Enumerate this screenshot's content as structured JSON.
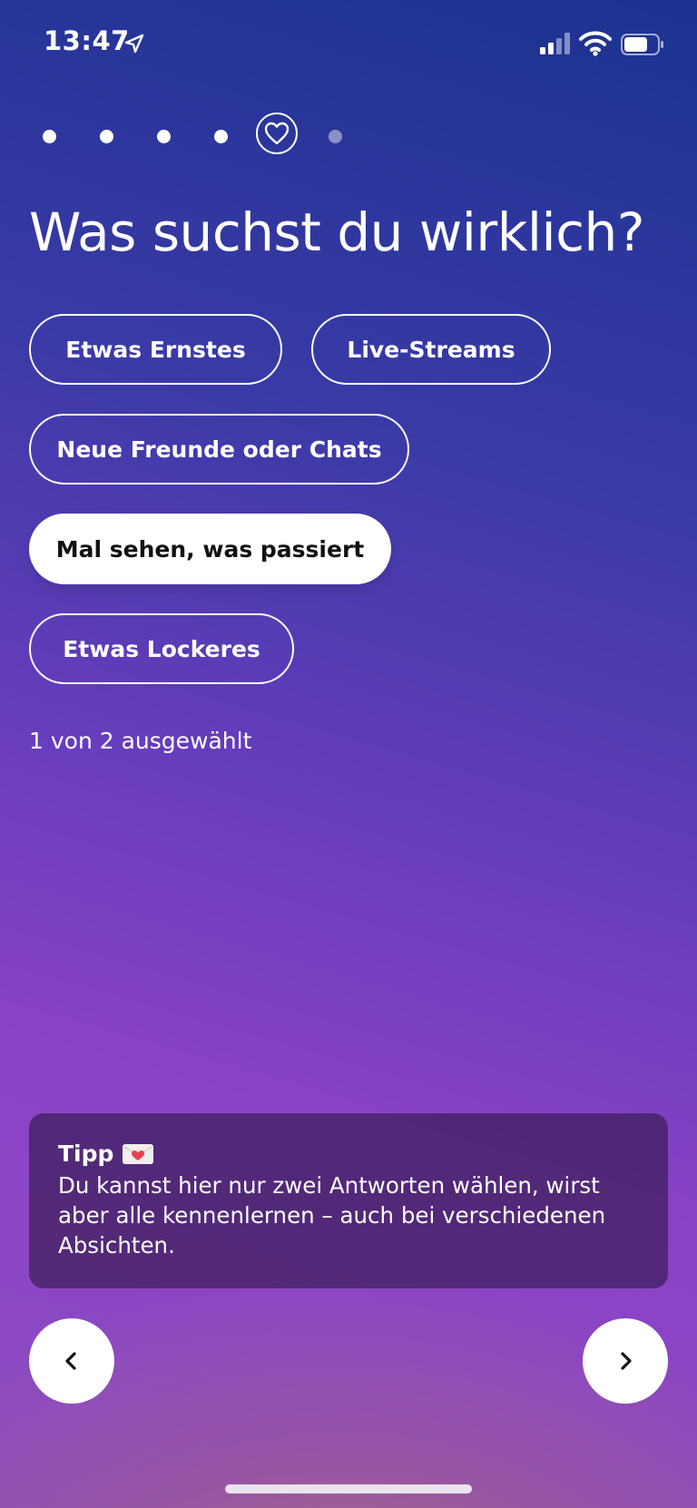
{
  "status_bar": {
    "time": "13:47",
    "location_icon": "location-arrow-icon",
    "signal_icon": "cellular-signal-icon",
    "wifi_icon": "wifi-icon",
    "battery_icon": "battery-icon"
  },
  "progress": {
    "total_steps": 6,
    "current_step": 5,
    "current_icon": "heart-icon"
  },
  "question": {
    "title": "Was suchst du wirklich?"
  },
  "options": [
    {
      "label": "Etwas Ernstes",
      "selected": false
    },
    {
      "label": "Live-Streams",
      "selected": false
    },
    {
      "label": "Neue Freunde oder Chats",
      "selected": false
    },
    {
      "label": "Mal sehen, was passiert",
      "selected": true
    },
    {
      "label": "Etwas Lockeres",
      "selected": false
    }
  ],
  "selection_count": "1 von 2 ausgewählt",
  "tip": {
    "title": "Tipp",
    "emoji_icon": "love-letter-icon",
    "text": "Du kannst hier nur zwei Antworten wählen, wirst aber alle kennenlernen – auch bei verschiedenen Absichten."
  },
  "navigation": {
    "back_icon": "chevron-left-icon",
    "next_icon": "chevron-right-icon"
  },
  "colors": {
    "gradient_top": "#1b3290",
    "gradient_mid": "#8a42c6",
    "gradient_bottom": "#b27a84",
    "tip_background": "#301848",
    "selected_chip": "#ffffff"
  }
}
